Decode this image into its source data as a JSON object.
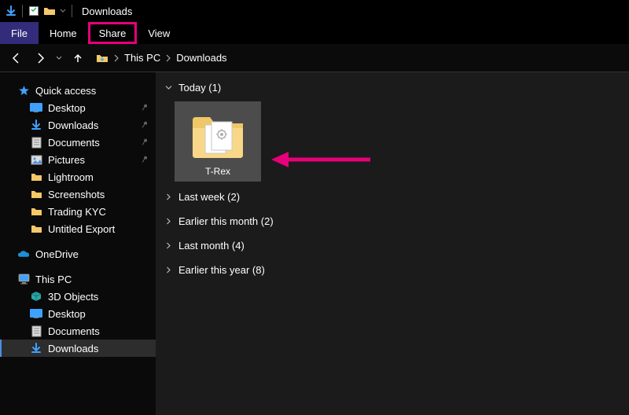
{
  "colors": {
    "accent_pink": "#e6007a",
    "accent_blue": "#4a90e2",
    "ribbon_file": "#332c7a"
  },
  "titlebar": {
    "app_icon": "download-arrow-icon",
    "qat_icon": "properties-icon",
    "qat2_icon": "folder-icon",
    "title": "Downloads"
  },
  "ribbon": {
    "file": "File",
    "home": "Home",
    "share": "Share",
    "view": "View"
  },
  "nav": {
    "back": "←",
    "forward": "→",
    "down": "⌄",
    "up": "↑"
  },
  "addressbar": {
    "root_icon": "download-folder-icon",
    "parts": [
      "This PC",
      "Downloads"
    ]
  },
  "sidebar": {
    "quick": {
      "label": "Quick access",
      "items": [
        {
          "label": "Desktop",
          "icon": "desktop-icon",
          "pin": true
        },
        {
          "label": "Downloads",
          "icon": "downloads-icon",
          "pin": true
        },
        {
          "label": "Documents",
          "icon": "documents-icon",
          "pin": true
        },
        {
          "label": "Pictures",
          "icon": "pictures-icon",
          "pin": true
        },
        {
          "label": "Lightroom",
          "icon": "folder-icon",
          "pin": false
        },
        {
          "label": "Screenshots",
          "icon": "folder-icon",
          "pin": false
        },
        {
          "label": "Trading KYC",
          "icon": "folder-icon",
          "pin": false
        },
        {
          "label": "Untitled Export",
          "icon": "folder-icon",
          "pin": false
        }
      ]
    },
    "onedrive": {
      "label": "OneDrive"
    },
    "thispc": {
      "label": "This PC",
      "items": [
        {
          "label": "3D Objects",
          "icon": "objects3d-icon"
        },
        {
          "label": "Desktop",
          "icon": "desktop-icon"
        },
        {
          "label": "Documents",
          "icon": "documents-icon"
        },
        {
          "label": "Downloads",
          "icon": "downloads-icon",
          "selected": true
        }
      ]
    }
  },
  "main": {
    "groups": [
      {
        "label": "Today (1)",
        "expanded": true,
        "items": [
          {
            "name": "T-Rex",
            "icon": "theme-folder-icon",
            "selected": true
          }
        ]
      },
      {
        "label": "Last week (2)",
        "expanded": false
      },
      {
        "label": "Earlier this month (2)",
        "expanded": false
      },
      {
        "label": "Last month (4)",
        "expanded": false
      },
      {
        "label": "Earlier this year (8)",
        "expanded": false
      }
    ]
  }
}
